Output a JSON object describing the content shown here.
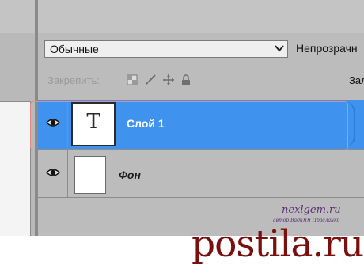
{
  "layers_panel": {
    "blend_mode": "Обычные",
    "opacity_label": "Непрозрачн",
    "lock_label": "Закрепить:",
    "lock_icons": [
      "transparency-lock-icon",
      "brush-icon",
      "move-icon",
      "padlock-icon"
    ],
    "fill_label": "Зал",
    "layers": [
      {
        "name": "Слой 1",
        "thumbnail_glyph": "T",
        "selected": true,
        "visible": true
      },
      {
        "name": "Фон",
        "thumbnail_glyph": "",
        "selected": false,
        "visible": true
      }
    ],
    "colors": {
      "selection": "#3f93ee",
      "panel": "#bcbcbc"
    }
  },
  "watermark": {
    "site": "nexlgem.ru",
    "author": "автор Вадимм Прасланко"
  },
  "logo": {
    "text": "postila.ru"
  }
}
